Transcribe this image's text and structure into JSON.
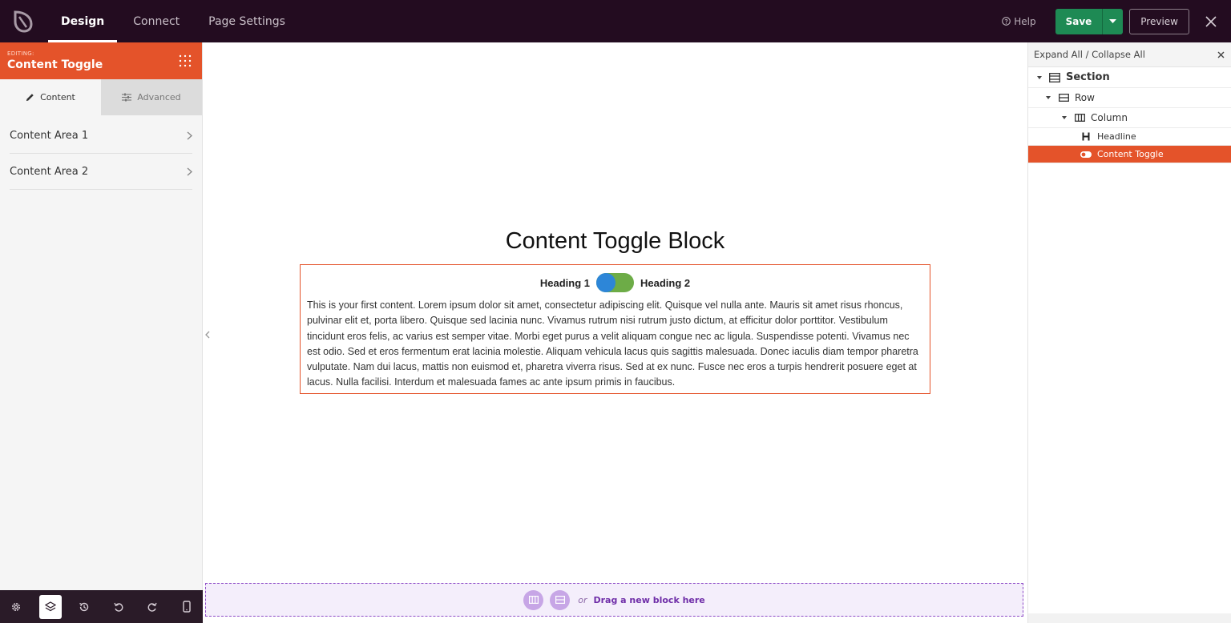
{
  "topbar": {
    "tabs": [
      {
        "label": "Design",
        "active": true
      },
      {
        "label": "Connect",
        "active": false
      },
      {
        "label": "Page Settings",
        "active": false
      }
    ],
    "help_label": "Help",
    "save_label": "Save",
    "preview_label": "Preview"
  },
  "left_panel": {
    "editing_label": "EDITING:",
    "editing_title": "Content Toggle",
    "tabs": [
      {
        "label": "Content",
        "icon": "pencil-icon",
        "active": true
      },
      {
        "label": "Advanced",
        "icon": "sliders-icon",
        "active": false
      }
    ],
    "sections": [
      {
        "label": "Content Area 1"
      },
      {
        "label": "Content Area 2"
      }
    ]
  },
  "canvas": {
    "headline": "Content Toggle Block",
    "toggle": {
      "heading_1": "Heading 1",
      "heading_2": "Heading 2",
      "content": "This is your first content. Lorem ipsum dolor sit amet, consectetur adipiscing elit. Quisque vel nulla ante. Mauris sit amet risus rhoncus, pulvinar elit et, porta libero. Quisque sed lacinia nunc. Vivamus rutrum nisi rutrum justo dictum, at efficitur dolor porttitor. Vestibulum tincidunt eros felis, ac varius est semper vitae. Morbi eget purus a velit aliquam congue nec ac ligula. Suspendisse potenti. Vivamus nec est odio. Sed et eros fermentum erat lacinia molestie. Aliquam vehicula lacus quis sagittis malesuada. Donec iaculis diam tempor pharetra vulputate. Nam dui lacus, mattis non euismod et, pharetra viverra risus. Sed at ex nunc. Fusce nec eros a turpis hendrerit posuere eget at lacus. Nulla facilisi. Interdum et malesuada fames ac ante ipsum primis in faucibus."
    },
    "dropzone": {
      "or_label": "or",
      "text": "Drag a new block here"
    }
  },
  "right_panel": {
    "header": "Expand All / Collapse All",
    "tree": {
      "section": "Section",
      "row": "Row",
      "column": "Column",
      "headline": "Headline",
      "content_toggle": "Content Toggle"
    }
  },
  "colors": {
    "topbar_bg": "#230c20",
    "accent_orange": "#e4532a",
    "save_green": "#1e8a54",
    "toggle_green": "#6dac47",
    "toggle_blue": "#2d86d8",
    "dropzone_purple": "#8d4bc7"
  }
}
